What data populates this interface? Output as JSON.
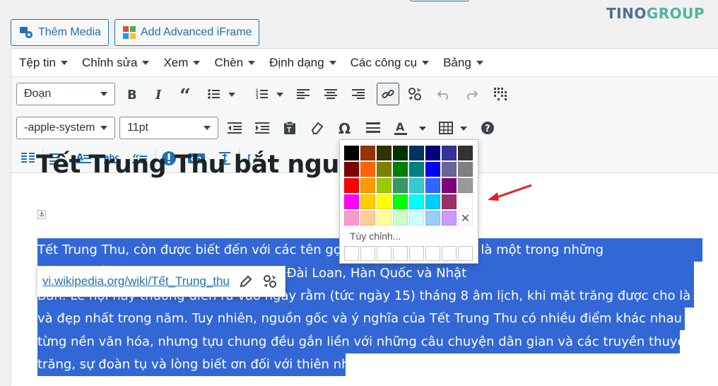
{
  "buttons": {
    "add_media": "Thêm Media",
    "add_iframe": "Add Advanced iFrame"
  },
  "logo": {
    "part1": "TINO",
    "part2": "GROUP"
  },
  "menubar": [
    "Tệp tin",
    "Chỉnh sửa",
    "Xem",
    "Chèn",
    "Định dạng",
    "Các công cụ",
    "Bảng"
  ],
  "toolbar": {
    "format_select": "Đoạn",
    "font_select": "-apple-system",
    "size_select": "11pt"
  },
  "content": {
    "heading": "Tết Trung Thu bắt nguồ",
    "lines": [
      "Tết Trung Thu, còn được biết đến với các tên gọi kh                                    ay Tết Thiếu Nhi, là một trong những",
      "                                                 gia Đông Á như Việt Nam, Trung Quốc, Đài Loan, Hàn Quốc và Nhật",
      "Bản. Lễ hội này thường diễn ra vào ngày rằm (tức ngày 15) tháng 8 âm lịch, khi mặt trăng được cho là sáng nhất",
      "và đẹp nhất trong năm. Tuy nhiên, nguồn gốc và ý nghĩa của Tết Trung Thu có nhiều điểm khác nhau tùy theo",
      "từng nền văn hóa, nhưng tựu chung đều gắn liền với những câu chuyện dân gian và các truyền thuyết về mặt",
      "trăng, sự đoàn tụ và lòng biết ơn đối với thiên nhiên."
    ]
  },
  "link_popup": {
    "url": "vi.wikipedia.org/wiki/Tết_Trung_thu"
  },
  "color_picker": {
    "custom_label": "Tùy chỉnh...",
    "swatches": [
      "#000000",
      "#993300",
      "#333300",
      "#003300",
      "#003366",
      "#000080",
      "#333399",
      "#333333",
      "#800000",
      "#ff6600",
      "#808000",
      "#008000",
      "#008080",
      "#0000ff",
      "#666699",
      "#808080",
      "#ff0000",
      "#ff9900",
      "#99cc00",
      "#339966",
      "#33cccc",
      "#3366ff",
      "#800080",
      "#999999",
      "#ff00ff",
      "#ffcc00",
      "#ffff00",
      "#00ff00",
      "#00ffff",
      "#00ccff",
      "#993366",
      "#ffffff",
      "#ff99cc",
      "#ffcc99",
      "#ffff99",
      "#ccffcc",
      "#ccffff",
      "#99ccff",
      "#cc99ff",
      "remove"
    ]
  },
  "colors": {
    "accent": "#2271b1",
    "selection": "#3367d6",
    "arrow": "#e02020"
  }
}
